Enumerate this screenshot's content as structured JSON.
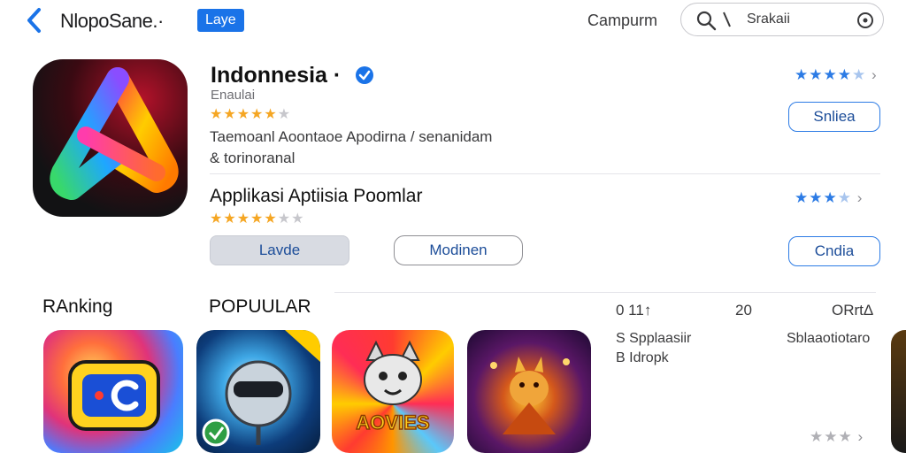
{
  "header": {
    "back_icon": "chevron-left-icon",
    "app_name": "NlopoSane.·",
    "tag": "Laye",
    "right_label": "Campurm",
    "search": {
      "value": "Srakaii",
      "placeholder": "Srakaii"
    }
  },
  "app": {
    "title": "Indonnesia ·",
    "verified_icon": "verified-check-icon",
    "subtitle": "Enaulai",
    "rating_stars": 4.5,
    "description_line1": "Taemoanl Aoontaoe Apodirna / senanidam",
    "description_line2": "& torinoranal",
    "right_action_label": "Snliea"
  },
  "section": {
    "title": "Applikasi Aptiisia Poomlar",
    "rating_stars": 4,
    "button_grey": "Lavde",
    "button_outline": "Modinen",
    "right_action_label": "Cndia"
  },
  "right_ratings": {
    "row1": "★★★★",
    "row2": "★★★",
    "row3": "★★★",
    "chevron": "›"
  },
  "lower": {
    "ranking_label": "RAnking",
    "popular_label": "POPUULAR",
    "col_a": "0 11↑",
    "col_b": "20",
    "col_c": "ORrtΔ",
    "list_a1": "S Spplaasiir",
    "list_a2": "B Idropk",
    "list_b1": "Sblaaotiotaro",
    "tiles": [
      {
        "name": "tv-app-icon",
        "accent": "#ffd45c"
      },
      {
        "name": "robot-ball-app-icon",
        "accent": "#3fa8e6"
      },
      {
        "name": "cat-movies-app-icon",
        "caption": "AOVIES",
        "accent": "#ffcc00"
      },
      {
        "name": "fox-game-app-icon",
        "accent": "#d4581b"
      }
    ]
  },
  "colors": {
    "accent": "#2c7be5",
    "tag_bg": "#1a73e8",
    "star": "#f5a623"
  }
}
